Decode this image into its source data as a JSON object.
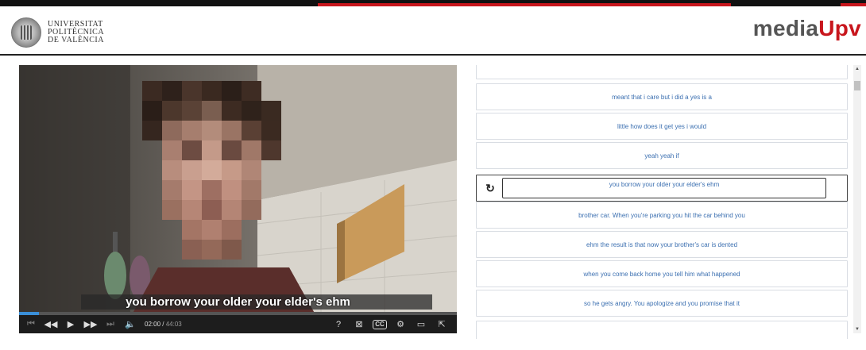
{
  "header": {
    "university": [
      "UNIVERSITAT",
      "POLITÈCNICA",
      "DE VALÈNCIA"
    ],
    "brand_media": "media",
    "brand_upv": "Upv"
  },
  "player": {
    "subtitle": "you borrow your older your elder's ehm",
    "current_time": "02:00",
    "separator": " / ",
    "total_time": "44:03",
    "progress_fraction": 0.045,
    "icons": [
      "skip-start-icon",
      "rewind-icon",
      "play-icon",
      "fast-forward-icon",
      "skip-end-icon",
      "volume-icon",
      "help-icon",
      "bookmark-icon",
      "closed-captions-icon",
      "settings-icon",
      "screen-icon",
      "external-link-icon"
    ],
    "cc_label": "CC"
  },
  "transcript": {
    "segments": [
      "meant that i care but i did a yes is a",
      "little how does it get yes i would",
      "yeah yeah if",
      "you borrow your older your elder's ehm",
      "brother car. When you're parking you hit the car behind you",
      "ehm the result is that now your brother's car is dented",
      "when you come back home you tell him what happened",
      "so he gets angry. You apologize and you promise that it"
    ],
    "active_index": 3
  },
  "colors": {
    "accent_red": "#c8161d",
    "link_blue": "#3b6fb0",
    "progress_blue": "#3a8fd8"
  }
}
